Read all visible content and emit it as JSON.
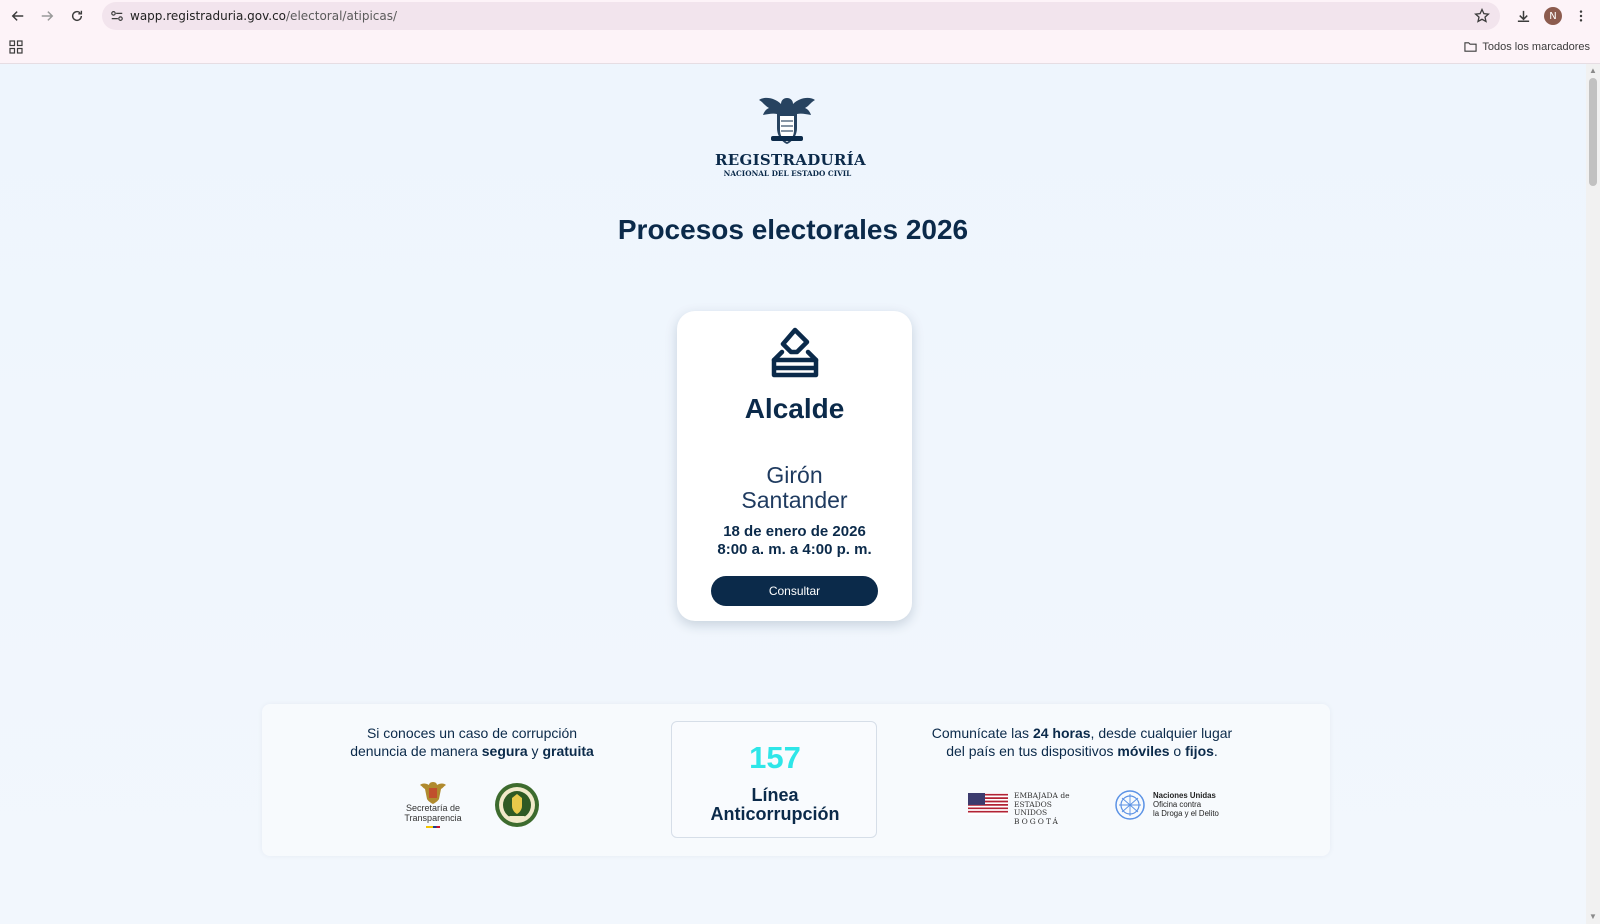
{
  "browser": {
    "url_host": "wapp.registraduria.gov.co",
    "url_path": "/electoral/atipicas/",
    "profile_initial": "N",
    "bookmarks_label": "Todos los marcadores"
  },
  "logo": {
    "name": "REGISTRADURÍA",
    "subtitle": "NACIONAL DEL ESTADO CIVIL"
  },
  "page": {
    "title": "Procesos electorales 2026"
  },
  "card": {
    "office": "Alcalde",
    "municipality": "Girón",
    "department": "Santander",
    "date": "18 de enero de 2026",
    "hours": "8:00 a. m. a 4:00 p. m.",
    "button_label": "Consultar"
  },
  "banner": {
    "left_line1": "Si conoces un caso de corrupción",
    "left_line2_pre": "denuncia de manera ",
    "left_bold1": "segura",
    "left_mid": " y ",
    "left_bold2": "gratuita",
    "hotline_number": "157",
    "hotline_label1": "Línea",
    "hotline_label2": "Anticorrupción",
    "right_pre": "Comunícate las ",
    "right_bold1": "24 horas",
    "right_mid1": ", desde cualquier lugar",
    "right_line2_pre": "del país en tus dispositivos ",
    "right_bold2": "móviles",
    "right_mid2": " o ",
    "right_bold3": "fijos",
    "right_end": ".",
    "transparencia_line1": "Secretaría de",
    "transparencia_line2": "Transparencia",
    "embajada_line1": "EMBAJADA de",
    "embajada_line2": "ESTADOS UNIDOS",
    "embajada_line3": "BOGOTÁ",
    "unodc_line1": "Naciones Unidas",
    "unodc_line2": "Oficina contra",
    "unodc_line3": "la Droga y el Delito"
  },
  "colors": {
    "navy": "#0b2a4a",
    "accent_cyan": "#2ee6e8",
    "page_bg": "#eef5fd"
  }
}
